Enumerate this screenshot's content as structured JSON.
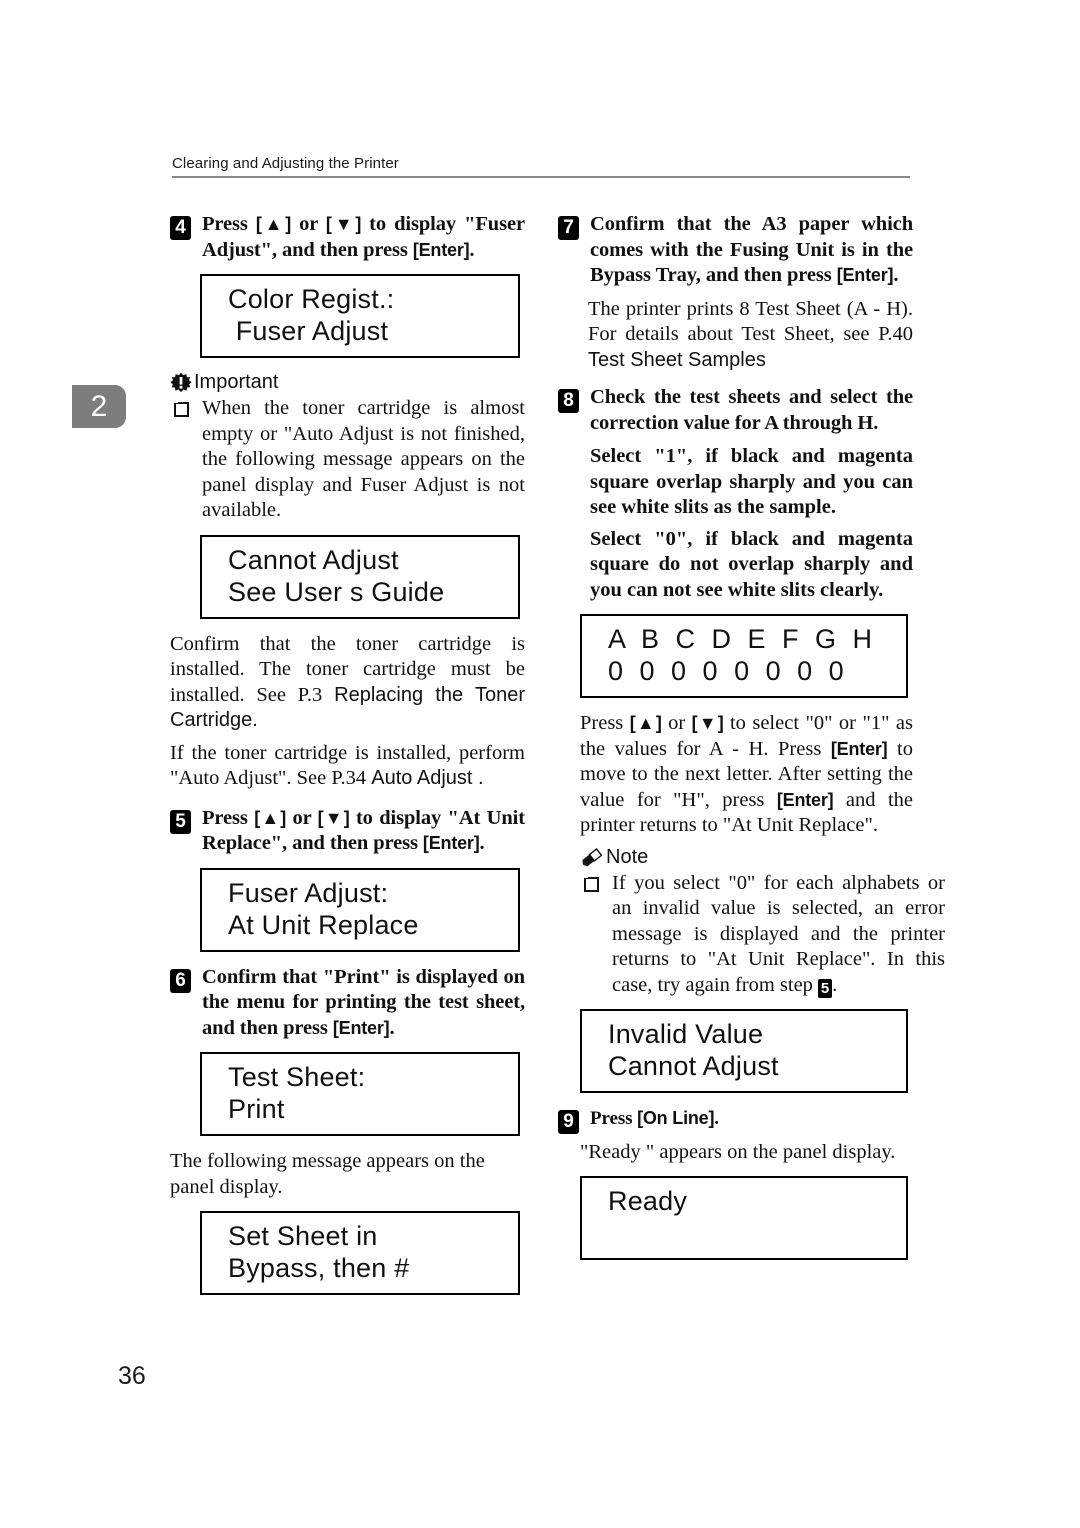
{
  "header": {
    "running_title": "Clearing and Adjusting the Printer"
  },
  "chapter_tab": {
    "number": "2"
  },
  "page_number": "36",
  "left_column": {
    "step4": {
      "number": "4",
      "text_a": "Press ",
      "kbd_up": "[▲]",
      "text_b": " or ",
      "kbd_down": "[▼]",
      "text_c": " to display \"Fuser Adjust\", and then press ",
      "kbd_enter": "[Enter]",
      "text_d": "."
    },
    "lcd_color_regist": {
      "line1": "Color Regist.:",
      "line2": " Fuser Adjust"
    },
    "important": {
      "label": "Important",
      "icon": "important-burst-icon",
      "item1": "When the toner cartridge is almost empty or \"Auto Adjust  is not finished, the following message appears on the panel display and Fuser Adjust is not available."
    },
    "lcd_cannot_adjust": {
      "line1": "Cannot Adjust",
      "line2": "See User s Guide"
    },
    "para_confirm_toner_a": "Confirm that the toner cartridge is installed. The toner cartridge must be installed. See P.3",
    "para_confirm_toner_b": "Replacing the Toner Cartridge.",
    "para_if_installed_a": "If the toner cartridge is installed, perform \"Auto Adjust\". See P.34",
    "para_if_installed_b": "Auto Adjust .",
    "step5": {
      "number": "5",
      "text_a": "Press ",
      "kbd_up": "[▲]",
      "text_b": " or ",
      "kbd_down": "[▼]",
      "text_c": " to display \"At Unit Replace\", and then press ",
      "kbd_enter": "[Enter]",
      "text_d": "."
    },
    "lcd_fuser_adjust": {
      "line1": "Fuser Adjust:",
      "line2": "At Unit Replace"
    },
    "step6": {
      "number": "6",
      "text_a": "Confirm that \"Print\" is displayed on the menu for printing the test sheet, and then press ",
      "kbd_enter": "[Enter]",
      "text_d": "."
    },
    "lcd_test_sheet": {
      "line1": "Test Sheet:",
      "line2": "Print"
    },
    "para_following_message": "The following message appears on the panel display.",
    "lcd_set_sheet": {
      "line1": "Set Sheet in",
      "line2": "Bypass, then #"
    }
  },
  "right_column": {
    "step7": {
      "number": "7",
      "text_a": "Confirm that the A3 paper which comes with the Fusing Unit is in the Bypass Tray, and then press ",
      "kbd_enter": "[Enter]",
      "text_d": "."
    },
    "para_prints_a": "The printer prints 8 Test Sheet (A - H). For details about Test Sheet, see P.40",
    "para_prints_b": "Test Sheet Samples",
    "step8": {
      "number": "8",
      "text_a": "Check the test sheets and select the correction value for A through H."
    },
    "select_1": "Select \"1\", if black and magenta square overlap sharply and you can see white slits as the sample.",
    "select_0": "Select \"0\", if black and magenta square do not overlap sharply and you can not see white slits clearly.",
    "lcd_abcdefgh": {
      "line1": "A B C D E F G H",
      "line2": "0 0 0 0 0 0 0 0"
    },
    "para_press_select_a": "Press ",
    "kbd_up": "[▲]",
    "para_press_select_b": " or ",
    "kbd_down": "[▼]",
    "para_press_select_c": " to select \"0\" or \"1\" as the values for A - H. Press ",
    "kbd_enter1": "[Enter]",
    "para_press_select_d": " to move to the next letter. After setting the value for \"H\", press ",
    "kbd_enter2": "[Enter]",
    "para_press_select_e": " and the printer returns to \"At Unit Replace\".",
    "note": {
      "label": "Note",
      "icon": "note-pencil-icon",
      "item1_a": "If you select \"0\" for each alphabets or an invalid value is selected, an error message is displayed and the printer returns to \"At Unit Replace\". In this case, try again from step ",
      "item1_badge": "5",
      "item1_b": "."
    },
    "lcd_invalid_value": {
      "line1": "Invalid Value",
      "line2": "Cannot Adjust"
    },
    "step9": {
      "number": "9",
      "text_a": "Press ",
      "kbd_online": "[On Line]",
      "text_d": "."
    },
    "para_ready": "\"Ready \" appears on the panel display.",
    "lcd_ready": {
      "line1": "Ready",
      "line2": " "
    }
  },
  "colors": {
    "ink": "#111111",
    "tab_gray": "#7d7d7d",
    "rule_gray": "#8a8a8a"
  }
}
